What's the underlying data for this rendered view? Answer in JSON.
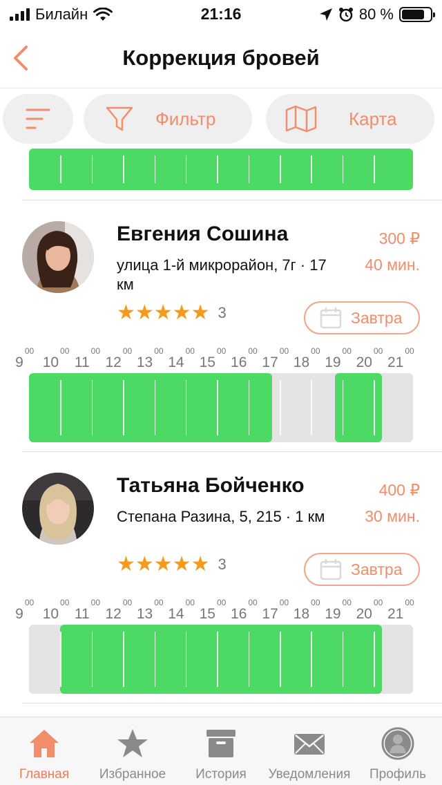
{
  "status_bar": {
    "carrier": "Билайн",
    "time": "21:16",
    "battery_text": "80 %"
  },
  "nav": {
    "title": "Коррекция бровей",
    "back_icon": "chevron-left-icon"
  },
  "toolbar": {
    "sort_icon": "sort-lines-icon",
    "filter_label": "Фильтр",
    "filter_icon": "funnel-icon",
    "map_label": "Карта",
    "map_icon": "map-icon"
  },
  "colors": {
    "accent": "#f28d6c",
    "available_slot": "#4cd964",
    "unavailable_slot": "#e4e4e4",
    "star": "#f59b1c"
  },
  "hours": [
    "9",
    "10",
    "11",
    "12",
    "13",
    "14",
    "15",
    "16",
    "17",
    "18",
    "19",
    "20",
    "21"
  ],
  "hour_minutes": "00",
  "masters": [
    {
      "name": "Евгения Сошина",
      "address": "улица 1-й микрорайон, 7г · 17 км",
      "price": "300 ₽",
      "duration": "40 мин.",
      "rating_stars": "★★★★★",
      "rating_value": 5,
      "reviews": "3",
      "date_label": "Завтра",
      "availability": [
        [
          9,
          16.75
        ],
        [
          18.75,
          20.25
        ]
      ]
    },
    {
      "name": "Татьяна Бойченко",
      "address": "Степана Разина, 5, 215 · 1 км",
      "price": "400 ₽",
      "duration": "30 мин.",
      "rating_stars": "★★★★★",
      "rating_value": 5,
      "reviews": "3",
      "date_label": "Завтра",
      "availability": [
        [
          10,
          20.25
        ]
      ]
    }
  ],
  "tabs": [
    {
      "label": "Главная",
      "icon": "home-icon",
      "active": true
    },
    {
      "label": "Избранное",
      "icon": "star-icon",
      "active": false
    },
    {
      "label": "История",
      "icon": "archive-box-icon",
      "active": false
    },
    {
      "label": "Уведомления",
      "icon": "envelope-icon",
      "active": false
    },
    {
      "label": "Профиль",
      "icon": "user-profile-icon",
      "active": false
    }
  ]
}
